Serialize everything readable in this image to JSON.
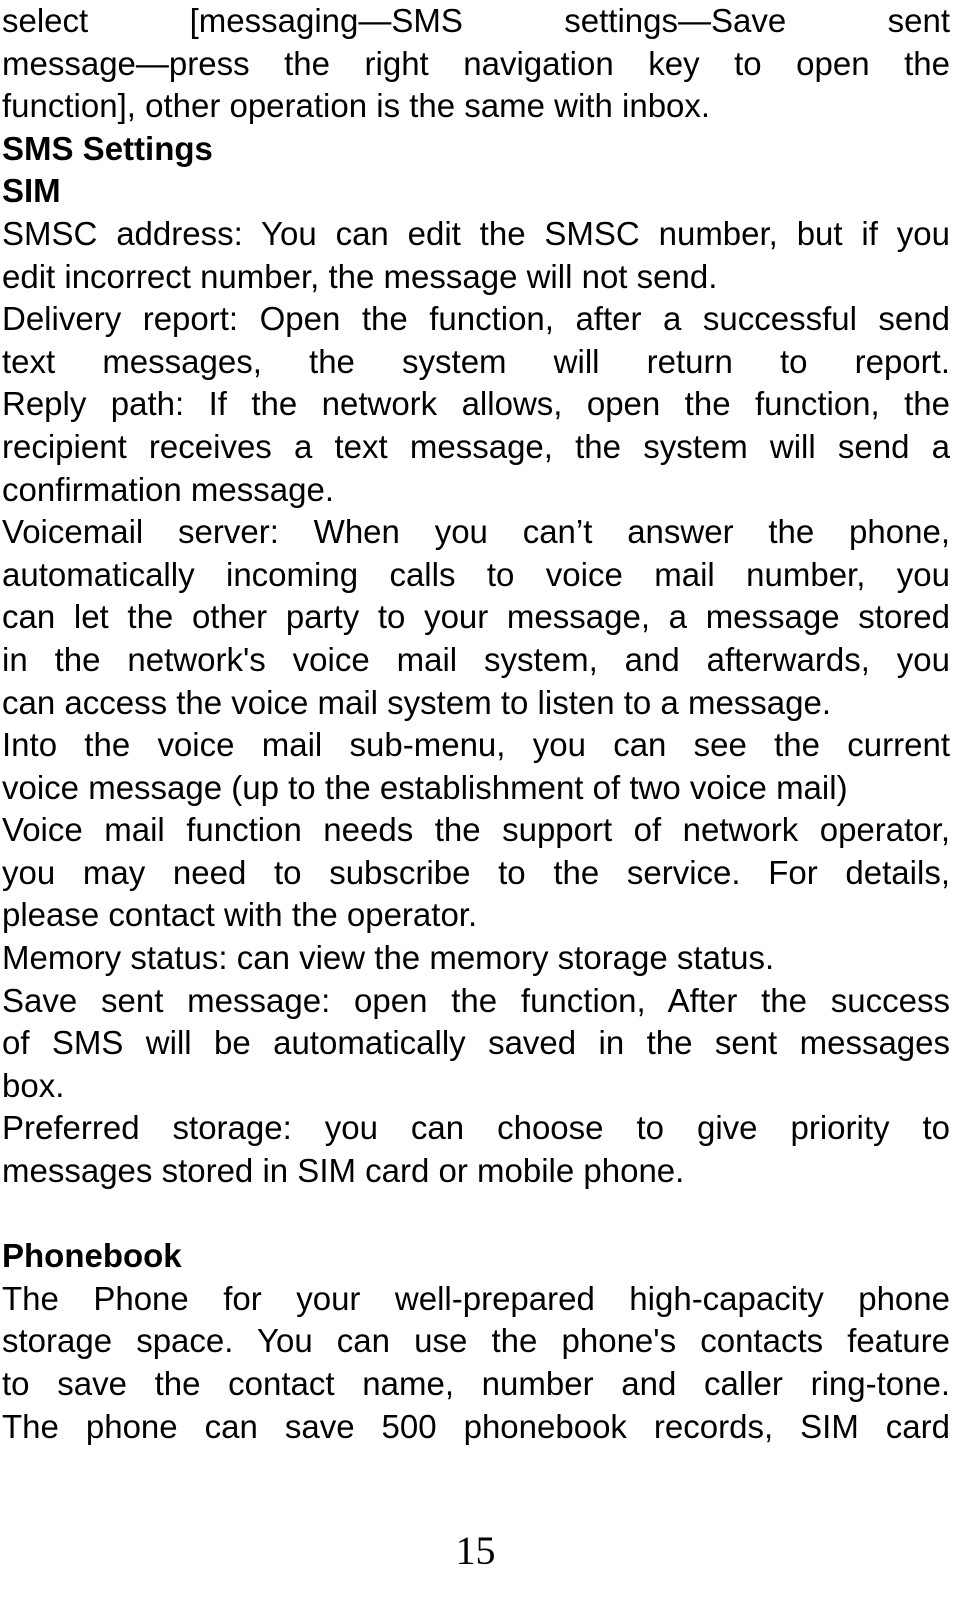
{
  "document": {
    "blocks": [
      {
        "type": "para",
        "name": "intro-paragraph",
        "lines": [
          "select [messaging—SMS settings—Save sent",
          "message—press the right navigation key to open the",
          "function], other operation is the same with inbox."
        ]
      },
      {
        "type": "heading",
        "name": "heading-sms-settings",
        "text": "SMS Settings"
      },
      {
        "type": "heading",
        "name": "heading-sim",
        "text": "SIM"
      },
      {
        "type": "para",
        "name": "smsc-address-paragraph",
        "lines": [
          "SMSC address: You can edit the SMSC number, but if you",
          "edit incorrect number, the message will not send."
        ]
      },
      {
        "type": "para",
        "name": "delivery-report-paragraph",
        "lines": [
          "Delivery report: Open the function, after a successful send",
          "text messages, the system will return to report.",
          "Reply path: If the network allows, open the function, the",
          "recipient receives a text message, the system will send a",
          "confirmation message."
        ]
      },
      {
        "type": "para",
        "name": "voicemail-server-paragraph",
        "lines": [
          "Voicemail server: When you can’t answer the phone,",
          "automatically incoming calls to voice mail number, you",
          "can let the other party to your message, a message stored",
          "in the network's voice mail system, and afterwards, you",
          "can access the voice mail system to listen to a message."
        ]
      },
      {
        "type": "para",
        "name": "voice-mail-submenu-paragraph",
        "lines": [
          "Into the voice mail sub-menu, you can see the current",
          "voice message (up to the establishment of two voice mail)"
        ]
      },
      {
        "type": "para",
        "name": "voice-mail-operator-paragraph",
        "lines": [
          "Voice mail function needs the support of network operator,",
          "you may need to subscribe to the service. For details,",
          "please contact with the operator."
        ]
      },
      {
        "type": "para",
        "name": "memory-status-paragraph",
        "lines": [
          "Memory status: can view the memory storage status."
        ]
      },
      {
        "type": "para",
        "name": "save-sent-message-paragraph",
        "lines": [
          "Save sent message: open the function, After the success",
          "of SMS will be automatically saved in the sent messages",
          "box."
        ]
      },
      {
        "type": "para",
        "name": "preferred-storage-paragraph",
        "lines": [
          "Preferred storage: you can choose to give priority to",
          "messages stored in SIM card or mobile phone."
        ]
      },
      {
        "type": "blank"
      },
      {
        "type": "heading",
        "name": "heading-phonebook",
        "text": "Phonebook"
      },
      {
        "type": "para",
        "name": "phonebook-paragraph",
        "lines": [
          "The Phone for your well-prepared high-capacity phone",
          "storage space. You can use the phone's contacts feature",
          "to save the contact name, number and caller ring-tone.",
          "The phone can save 500 phonebook records, SIM card"
        ],
        "continues": true
      }
    ]
  },
  "page_number": "15"
}
